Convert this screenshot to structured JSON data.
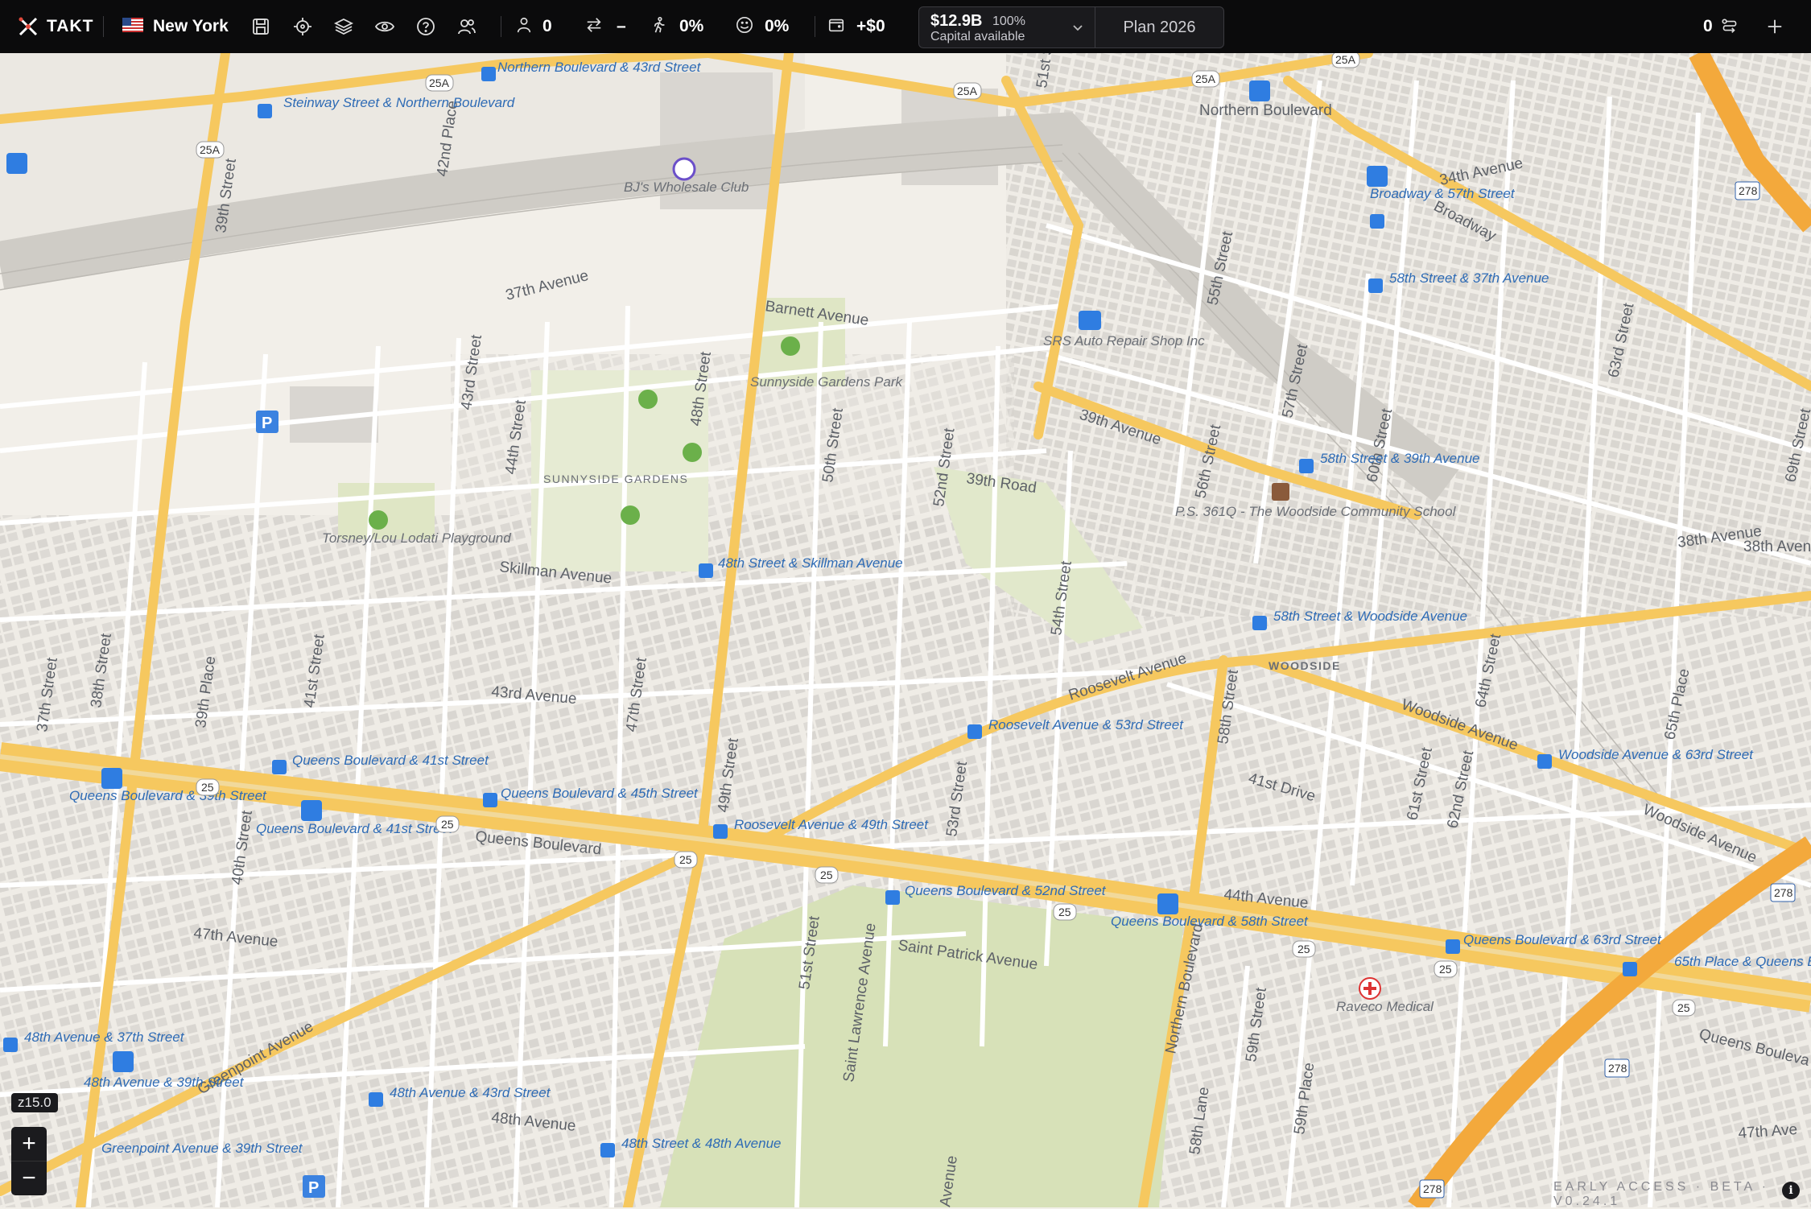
{
  "app": {
    "name": "TAKT",
    "city": "New York"
  },
  "toolbar": {
    "stats": [
      {
        "icon": "person-icon",
        "value": "0"
      },
      {
        "icon": "transfer-icon",
        "value": "–"
      },
      {
        "icon": "walking-icon",
        "value": "0%"
      },
      {
        "icon": "smiley-icon",
        "value": "0%"
      },
      {
        "icon": "wallet-icon",
        "value": "+$0"
      }
    ],
    "capital_amount": "$12.9B",
    "capital_percent": "100%",
    "capital_label": "Capital available",
    "plan_label": "Plan 2026",
    "route_count": "0"
  },
  "map": {
    "zoom_level": "z15.0",
    "beta_label": "EARLY ACCESS · BETA · V0.24.1",
    "streets": [
      "Northern Boulevard",
      "Broadway",
      "34th Avenue",
      "37th Avenue",
      "Barnett Avenue",
      "38th Avenue",
      "39th Avenue",
      "39th Road",
      "Skillman Avenue",
      "43rd Avenue",
      "Roosevelt Avenue",
      "Woodside Avenue",
      "Queens Boulevard",
      "41st Drive",
      "44th Avenue",
      "47th Avenue",
      "48th Avenue",
      "Greenpoint Avenue",
      "Saint Patrick Avenue",
      "Saint Lawrence Avenue",
      "Woodside Avenue",
      "48th Street",
      "39th Street",
      "43rd Street",
      "52nd Street",
      "58th Street",
      "50th Street",
      "42nd Place",
      "44th Street",
      "47th Street",
      "57th Street",
      "60th Street",
      "64th Street",
      "61st Street",
      "62nd Street",
      "65th Place",
      "69th Street",
      "63rd Street",
      "55th Street",
      "56th Street",
      "54th Street",
      "53rd Street",
      "49th Street",
      "51st Street",
      "40th Street",
      "41st Street",
      "38th Street",
      "37th Street",
      "39th Place",
      "58th Lane",
      "59th Place",
      "59th Street",
      "Avenue",
      "51st St",
      "Northern Boulevard",
      "Queens Bouleva",
      "47th Ave",
      "38th Aven"
    ],
    "pois": [
      "BJ's Wholesale Club",
      "Sunnyside Gardens Park",
      "SUNNYSIDE GARDENS",
      "Torsney/Lou Lodati Playground",
      "SRS Auto Repair Shop Inc",
      "P.S. 361Q - The Woodside Community School",
      "WOODSIDE",
      "Raveco Medical"
    ],
    "transit_stops": [
      "Northern Boulevard & 43rd Street",
      "Steinway Street & Northern Boulevard",
      "Broadway & 57th Street",
      "58th Street & 37th Avenue",
      "58th Street & 39th Avenue",
      "48th Street & Skillman Avenue",
      "58th Street & Woodside Avenue",
      "Roosevelt Avenue & 53rd Street",
      "Woodside Avenue & 63rd Street",
      "Queens Boulevard & 41st Street",
      "Queens Boulevard & 39th Street",
      "Queens Boulevard & 45th Street",
      "Queens Boulevard & 41st Street",
      "Roosevelt Avenue & 49th Street",
      "Queens Boulevard & 52nd Street",
      "Queens Boulevard & 58th Street",
      "Queens Boulevard & 63rd Street",
      "65th Place & Queens Boulevard",
      "48th Avenue & 37th Street",
      "48th Avenue & 39th Street",
      "48th Avenue & 43rd Street",
      "Greenpoint Avenue & 39th Street",
      "48th Street & 48th Avenue"
    ],
    "route_shields": [
      "25A",
      "25",
      "278"
    ],
    "colors": {
      "land": "#f2efe9",
      "park": "#dfe6c5",
      "major_road": "#f6c85f",
      "highway": "#f3a93c",
      "building": "#d4d1cc",
      "transit": "#2f7de1"
    }
  }
}
